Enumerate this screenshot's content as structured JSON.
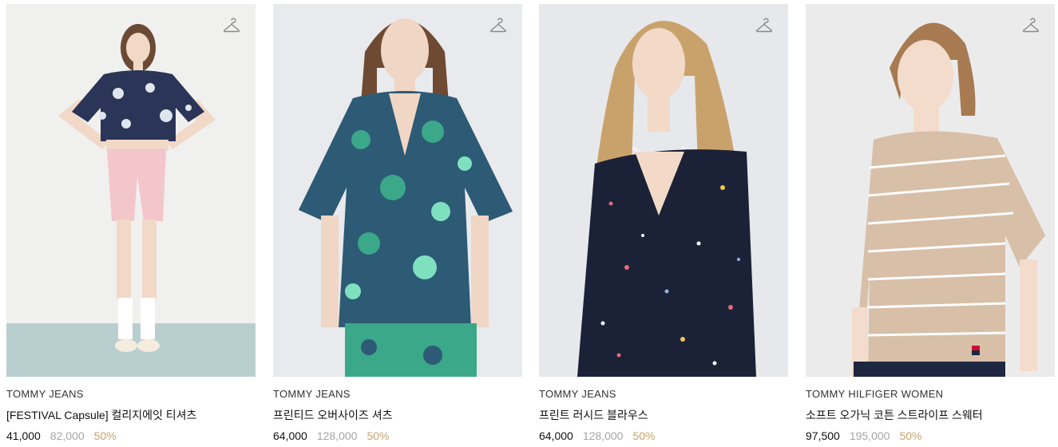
{
  "products": [
    {
      "brand": "TOMMY JEANS",
      "name": "[FESTIVAL Capsule] 컬리지에잇 티셔츠",
      "price": "41,000",
      "original_price": "82,000",
      "discount": "50%",
      "bg_color": "#eeeeee",
      "top_color": "#2a3557",
      "bottom_color": "#f3c6cc"
    },
    {
      "brand": "TOMMY JEANS",
      "name": "프린티드 오버사이즈 셔츠",
      "price": "64,000",
      "original_price": "128,000",
      "discount": "50%",
      "bg_color": "#e9ebee",
      "top_color": "#2d5a74",
      "bottom_color": "#3aa889"
    },
    {
      "brand": "TOMMY JEANS",
      "name": "프린트 러시드 블라우스",
      "price": "64,000",
      "original_price": "128,000",
      "discount": "50%",
      "bg_color": "#e8e9ec",
      "top_color": "#1b2136",
      "bottom_color": "#1b2136"
    },
    {
      "brand": "TOMMY HILFIGER WOMEN",
      "name": "소프트 오가닉 코튼 스트라이프 스웨터",
      "price": "97,500",
      "original_price": "195,000",
      "discount": "50%",
      "bg_color": "#eaeaea",
      "top_color": "#d8bfa8",
      "bottom_color": "#1e2740"
    }
  ],
  "icons": {
    "wishlist": "hanger-icon"
  }
}
